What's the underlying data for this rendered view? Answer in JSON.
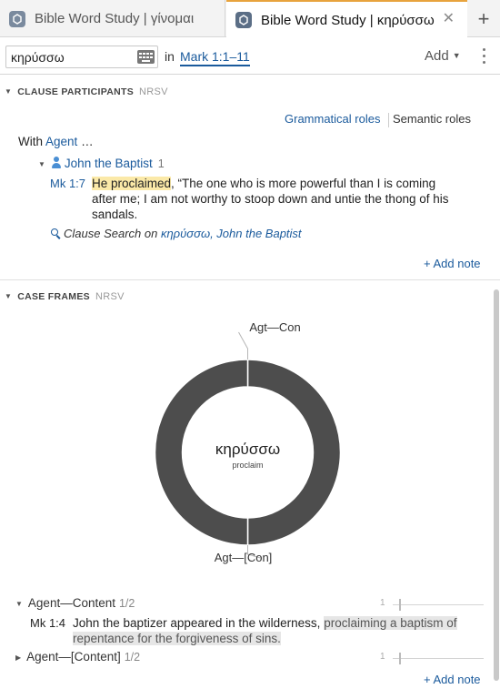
{
  "tabs": [
    {
      "title": "Bible Word Study | γίνομαι",
      "active": false
    },
    {
      "title": "Bible Word Study | κηρύσσω",
      "active": true,
      "close": "✕"
    }
  ],
  "new_tab": "+",
  "toolbar": {
    "search_value": "κηρύσσω",
    "in_label": "in",
    "reference": "Mark 1:1–11",
    "add_label": "Add",
    "add_caret": "▼"
  },
  "clause_participants": {
    "header": "CLAUSE PARTICIPANTS",
    "source": "NRSV",
    "role_options": [
      "Grammatical roles",
      "Semantic roles"
    ],
    "with_label": "With",
    "with_role": "Agent",
    "with_ellipsis": "…",
    "participant": {
      "name": "John the Baptist",
      "count": "1"
    },
    "verse": {
      "ref": "Mk 1:7",
      "highlight": "He proclaimed",
      "rest": ", “The one who is more powerful than I is coming after me; I am not worthy to stoop down and untie the thong of his sandals."
    },
    "clause_search": {
      "prefix": "Clause Search on",
      "term": "κηρύσσω, John the Baptist"
    },
    "add_note": "+ Add note"
  },
  "case_frames": {
    "header": "CASE FRAMES",
    "source": "NRSV",
    "frames": [
      {
        "label": "Agent—Content",
        "fraction": "1/2",
        "expanded": true,
        "spark_value": "1"
      },
      {
        "label": "Agent—[Content]",
        "fraction": "1/2",
        "expanded": false,
        "spark_value": "1"
      }
    ],
    "verse": {
      "ref": "Mk 1:4",
      "plain": "John the baptizer appeared in the wilderness, ",
      "highlight": "proclaiming a baptism of repentance for the forgiveness of sins."
    },
    "add_note": "+ Add note"
  },
  "chart_data": {
    "type": "pie",
    "style": "donut",
    "center_label": "κηρύσσω",
    "center_sublabel": "proclaim",
    "categories": [
      "Agt—Con",
      "Agt—[Con]"
    ],
    "values": [
      1,
      1
    ],
    "colors": [
      "#4d4d4d",
      "#4d4d4d"
    ]
  }
}
